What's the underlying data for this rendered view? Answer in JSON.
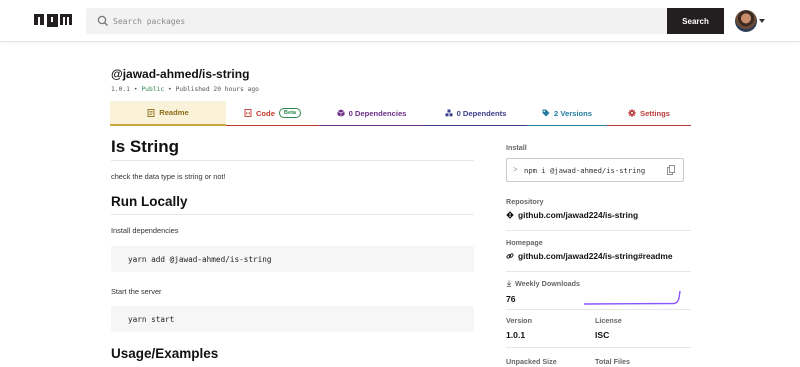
{
  "header": {
    "logo_text": "npm",
    "search_placeholder": "Search packages",
    "search_button": "Search"
  },
  "package": {
    "name": "@jawad-ahmed/is-string",
    "version": "1.0.1",
    "sep1": "•",
    "visibility": "Public",
    "sep2": "•",
    "published": "Published 20 hours ago"
  },
  "tabs": [
    {
      "label": "Readme",
      "icon": "readme-icon"
    },
    {
      "label": "Code",
      "badge": "Beta",
      "icon": "code-icon"
    },
    {
      "label": "0 Dependencies",
      "icon": "box-icon"
    },
    {
      "label": "0 Dependents",
      "icon": "cubes-icon"
    },
    {
      "label": "2 Versions",
      "icon": "tag-icon"
    },
    {
      "label": "Settings",
      "icon": "gear-icon"
    }
  ],
  "readme": {
    "title": "Is String",
    "description": "check the data type is string or not!",
    "section1": "Run Locally",
    "install_deps_label": "Install dependencies",
    "install_deps_code": "yarn add @jawad-ahmed/is-string",
    "start_label": "Start the server",
    "start_code": "yarn start",
    "section2": "Usage/Examples"
  },
  "sidebar": {
    "install_label": "Install",
    "install_cmd": "npm i @jawad-ahmed/is-string",
    "install_prompt": ">",
    "repository_label": "Repository",
    "repository_link": "github.com/jawad224/is-string",
    "homepage_label": "Homepage",
    "homepage_link": "github.com/jawad224/is-string#readme",
    "weekly_downloads_label": "Weekly Downloads",
    "weekly_downloads": "76",
    "version_label": "Version",
    "version": "1.0.1",
    "license_label": "License",
    "license": "ISC",
    "unpacked_size_label": "Unpacked Size",
    "total_files_label": "Total Files"
  },
  "colors": {
    "sparkline": "#8956ff",
    "public": "#2e8a4c"
  }
}
